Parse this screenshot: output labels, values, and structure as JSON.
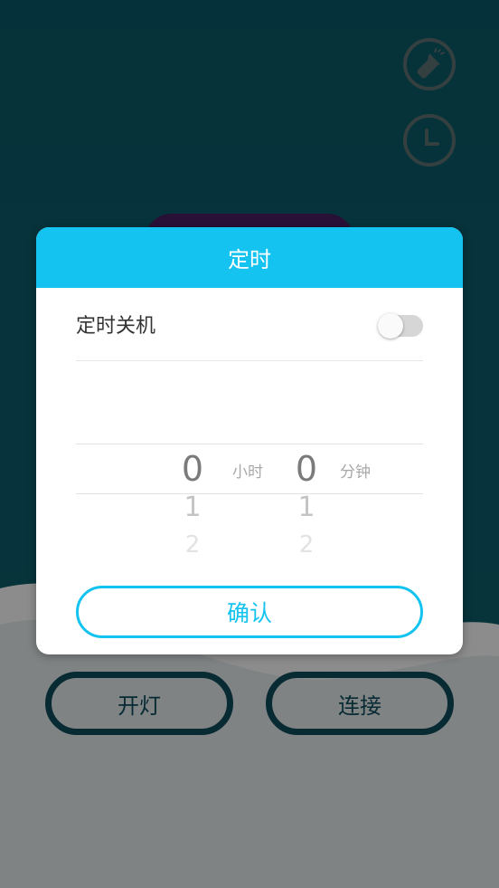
{
  "dialog": {
    "title": "定时",
    "shutdown_label": "定时关机",
    "shutdown_enabled": false,
    "confirm_label": "确认"
  },
  "picker": {
    "hours": {
      "selected": "0",
      "next": "1",
      "next2": "2",
      "unit": "小时"
    },
    "minutes": {
      "selected": "0",
      "next": "1",
      "next2": "2",
      "unit": "分钟"
    }
  },
  "buttons": {
    "light_label": "开灯",
    "connect_label": "连接"
  },
  "icons": {
    "flashlight": "flashlight-icon",
    "clock": "clock-icon"
  },
  "colors": {
    "accent": "#14c3ef",
    "background": "#0a5a6a",
    "pill_border": "#0d4e5e"
  }
}
